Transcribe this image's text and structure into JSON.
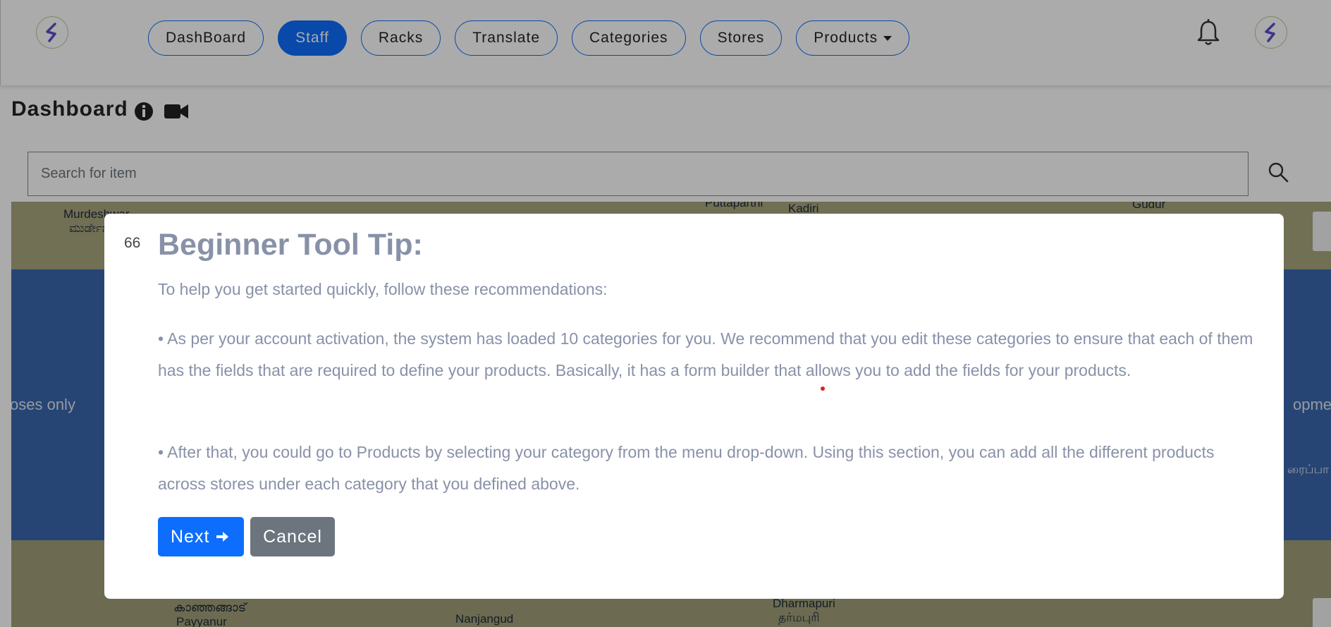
{
  "header": {
    "nav": [
      {
        "label": "DashBoard"
      },
      {
        "label": "Staff",
        "active": true
      },
      {
        "label": "Racks"
      },
      {
        "label": "Translate"
      },
      {
        "label": "Categories"
      },
      {
        "label": "Stores"
      },
      {
        "label": "Products",
        "dropdown": true
      }
    ],
    "icons": [
      "logo-icon",
      "bell-icon",
      "avatar-logo-icon"
    ]
  },
  "page": {
    "title": "Dashboard",
    "title_icons": [
      "info-icon",
      "video-camera-icon"
    ]
  },
  "search": {
    "placeholder": "Search for item",
    "value": "",
    "icon": "search-icon"
  },
  "map": {
    "labels": {
      "murdeshwar": "Murdeshwar",
      "murdeshwar_local": "ಮುರ್ಡೇಶ್ವರ",
      "kanhangad_local": "കാഞ്ഞങ്ങാട്",
      "payyanur": "Payyanur",
      "nanjangud": "Nanjangud",
      "dharmapuri": "Dharmapuri",
      "dharmapuri_local": "தர்மபுரி",
      "puttaparthi": "Puttaparthi",
      "kadiri": "Kadiri",
      "gudur": "Gudur",
      "left_watermark": "oses only",
      "right_watermark": "opment",
      "right_local": "ரைப்பா"
    }
  },
  "dialog": {
    "corner_text": "66",
    "title": "Beginner Tool Tip:",
    "intro": "To help you get started quickly, follow these recommendations:",
    "point1": "• As per your account activation, the system has loaded 10 categories for you. We recommend that you edit these categories to ensure that each of them has the fields that are required to define your products. Basically, it has a form builder that allows you to add the fields for your products.",
    "point2": "• After that, you could go to Products by selecting your category from the menu drop-down. Using this section, you can add all the different products across stores under each category that you defined above.",
    "next_label": "Next",
    "cancel_label": "Cancel"
  },
  "colors": {
    "primary": "#0d6efd",
    "secondary": "#6c757d",
    "dialog_text": "#8891a8"
  }
}
